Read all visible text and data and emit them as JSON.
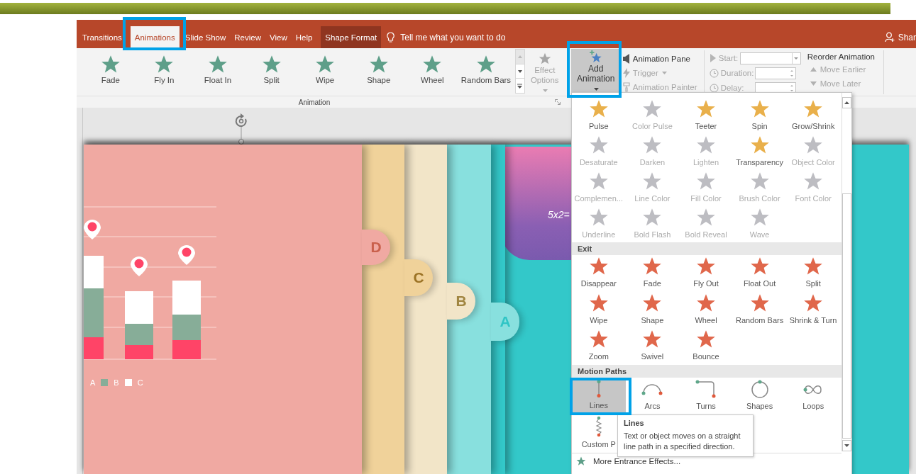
{
  "ribbon_tabs": [
    {
      "label": "Transitions",
      "kind": "tab",
      "selected": false
    },
    {
      "label": "Animations",
      "kind": "tab",
      "selected": true
    },
    {
      "label": "Slide Show",
      "kind": "tab",
      "selected": false
    },
    {
      "label": "Review",
      "kind": "tab",
      "selected": false
    },
    {
      "label": "View",
      "kind": "tab",
      "selected": false
    },
    {
      "label": "Help",
      "kind": "tab",
      "selected": false
    },
    {
      "label": "Shape Format",
      "kind": "contextual",
      "selected": false
    }
  ],
  "tell_me": {
    "label": "Tell me what you want to do"
  },
  "share": {
    "label": "Shar"
  },
  "animation_gallery": {
    "group_label": "Animation",
    "items": [
      {
        "label": "Fade",
        "selected": false
      },
      {
        "label": "Fly In",
        "selected": false
      },
      {
        "label": "Float In",
        "selected": false
      },
      {
        "label": "Split",
        "selected": false
      },
      {
        "label": "Wipe",
        "selected": false
      },
      {
        "label": "Shape",
        "selected": false
      },
      {
        "label": "Wheel",
        "selected": false
      },
      {
        "label": "Random Bars",
        "selected": false
      }
    ]
  },
  "effect_options": {
    "label": "Effect Options",
    "disabled": true
  },
  "add_animation": {
    "label": "Add Animation",
    "pressed": true
  },
  "advanced": [
    {
      "label": "Animation Pane",
      "kind": "pane",
      "disabled": false
    },
    {
      "label": "Trigger",
      "kind": "trigger",
      "disabled": true
    },
    {
      "label": "Animation Painter",
      "kind": "painter",
      "disabled": true
    }
  ],
  "timing": [
    {
      "label": "Start:",
      "kind": "dropdown",
      "disabled": true
    },
    {
      "label": "Duration:",
      "kind": "spinner",
      "disabled": true
    },
    {
      "label": "Delay:",
      "kind": "spinner",
      "disabled": true
    }
  ],
  "reorder": {
    "title": "Reorder Animation",
    "buttons": [
      {
        "label": "Move Earlier",
        "kind": "up",
        "disabled": true
      },
      {
        "label": "Move Later",
        "kind": "down",
        "disabled": true
      }
    ]
  },
  "slide": {
    "tabs": [
      "D",
      "C",
      "B",
      "A"
    ],
    "legend": [
      {
        "label": "A"
      },
      {
        "label": "B",
        "color": "#87ad98"
      },
      {
        "label": "C",
        "color": "#ffffff"
      }
    ],
    "illustration_text": "5x2="
  },
  "add_animation_menu": {
    "sections": [
      {
        "kind": "emphasis",
        "items": [
          {
            "label": "Pulse",
            "disabled": false,
            "selected": false
          },
          {
            "label": "Color Pulse",
            "disabled": true,
            "selected": false
          },
          {
            "label": "Teeter",
            "disabled": false,
            "selected": false
          },
          {
            "label": "Spin",
            "disabled": false,
            "selected": false
          },
          {
            "label": "Grow/Shrink",
            "disabled": false,
            "selected": false
          },
          {
            "label": "Desaturate",
            "disabled": true,
            "selected": false
          },
          {
            "label": "Darken",
            "disabled": true,
            "selected": false
          },
          {
            "label": "Lighten",
            "disabled": true,
            "selected": false
          },
          {
            "label": "Transparency",
            "disabled": false,
            "selected": false
          },
          {
            "label": "Object Color",
            "disabled": true,
            "selected": false
          },
          {
            "label": "Complemen...",
            "disabled": true,
            "selected": false
          },
          {
            "label": "Line Color",
            "disabled": true,
            "selected": false
          },
          {
            "label": "Fill Color",
            "disabled": true,
            "selected": false
          },
          {
            "label": "Brush Color",
            "disabled": true,
            "selected": false
          },
          {
            "label": "Font Color",
            "disabled": true,
            "selected": false
          },
          {
            "label": "Underline",
            "disabled": true,
            "selected": false
          },
          {
            "label": "Bold Flash",
            "disabled": true,
            "selected": false
          },
          {
            "label": "Bold Reveal",
            "disabled": true,
            "selected": false
          },
          {
            "label": "Wave",
            "disabled": true,
            "selected": false
          }
        ]
      },
      {
        "kind": "exit",
        "title": "Exit",
        "items": [
          {
            "label": "Disappear",
            "disabled": false,
            "selected": false
          },
          {
            "label": "Fade",
            "disabled": false,
            "selected": false
          },
          {
            "label": "Fly Out",
            "disabled": false,
            "selected": false
          },
          {
            "label": "Float Out",
            "disabled": false,
            "selected": false
          },
          {
            "label": "Split",
            "disabled": false,
            "selected": false
          },
          {
            "label": "Wipe",
            "disabled": false,
            "selected": false
          },
          {
            "label": "Shape",
            "disabled": false,
            "selected": false
          },
          {
            "label": "Wheel",
            "disabled": false,
            "selected": false
          },
          {
            "label": "Random Bars",
            "disabled": false,
            "selected": false
          },
          {
            "label": "Shrink & Turn",
            "disabled": false,
            "selected": false
          },
          {
            "label": "Zoom",
            "disabled": false,
            "selected": false
          },
          {
            "label": "Swivel",
            "disabled": false,
            "selected": false
          },
          {
            "label": "Bounce",
            "disabled": false,
            "selected": false
          }
        ]
      },
      {
        "kind": "path",
        "title": "Motion Paths",
        "items": [
          {
            "label": "Lines",
            "kind": "line",
            "disabled": false,
            "selected": true
          },
          {
            "label": "Arcs",
            "kind": "arc",
            "disabled": false,
            "selected": false
          },
          {
            "label": "Turns",
            "kind": "turn",
            "disabled": false,
            "selected": false
          },
          {
            "label": "Shapes",
            "kind": "shape",
            "disabled": false,
            "selected": false
          },
          {
            "label": "Loops",
            "kind": "loop",
            "disabled": false,
            "selected": false
          },
          {
            "label": "Custom P",
            "kind": "custom",
            "disabled": false,
            "selected": false
          }
        ]
      }
    ],
    "more": [
      {
        "label": "More Entrance Effects..."
      }
    ]
  },
  "tooltip": {
    "title": "Lines",
    "text": "Text or object moves on a straight line path in a specified direction."
  }
}
